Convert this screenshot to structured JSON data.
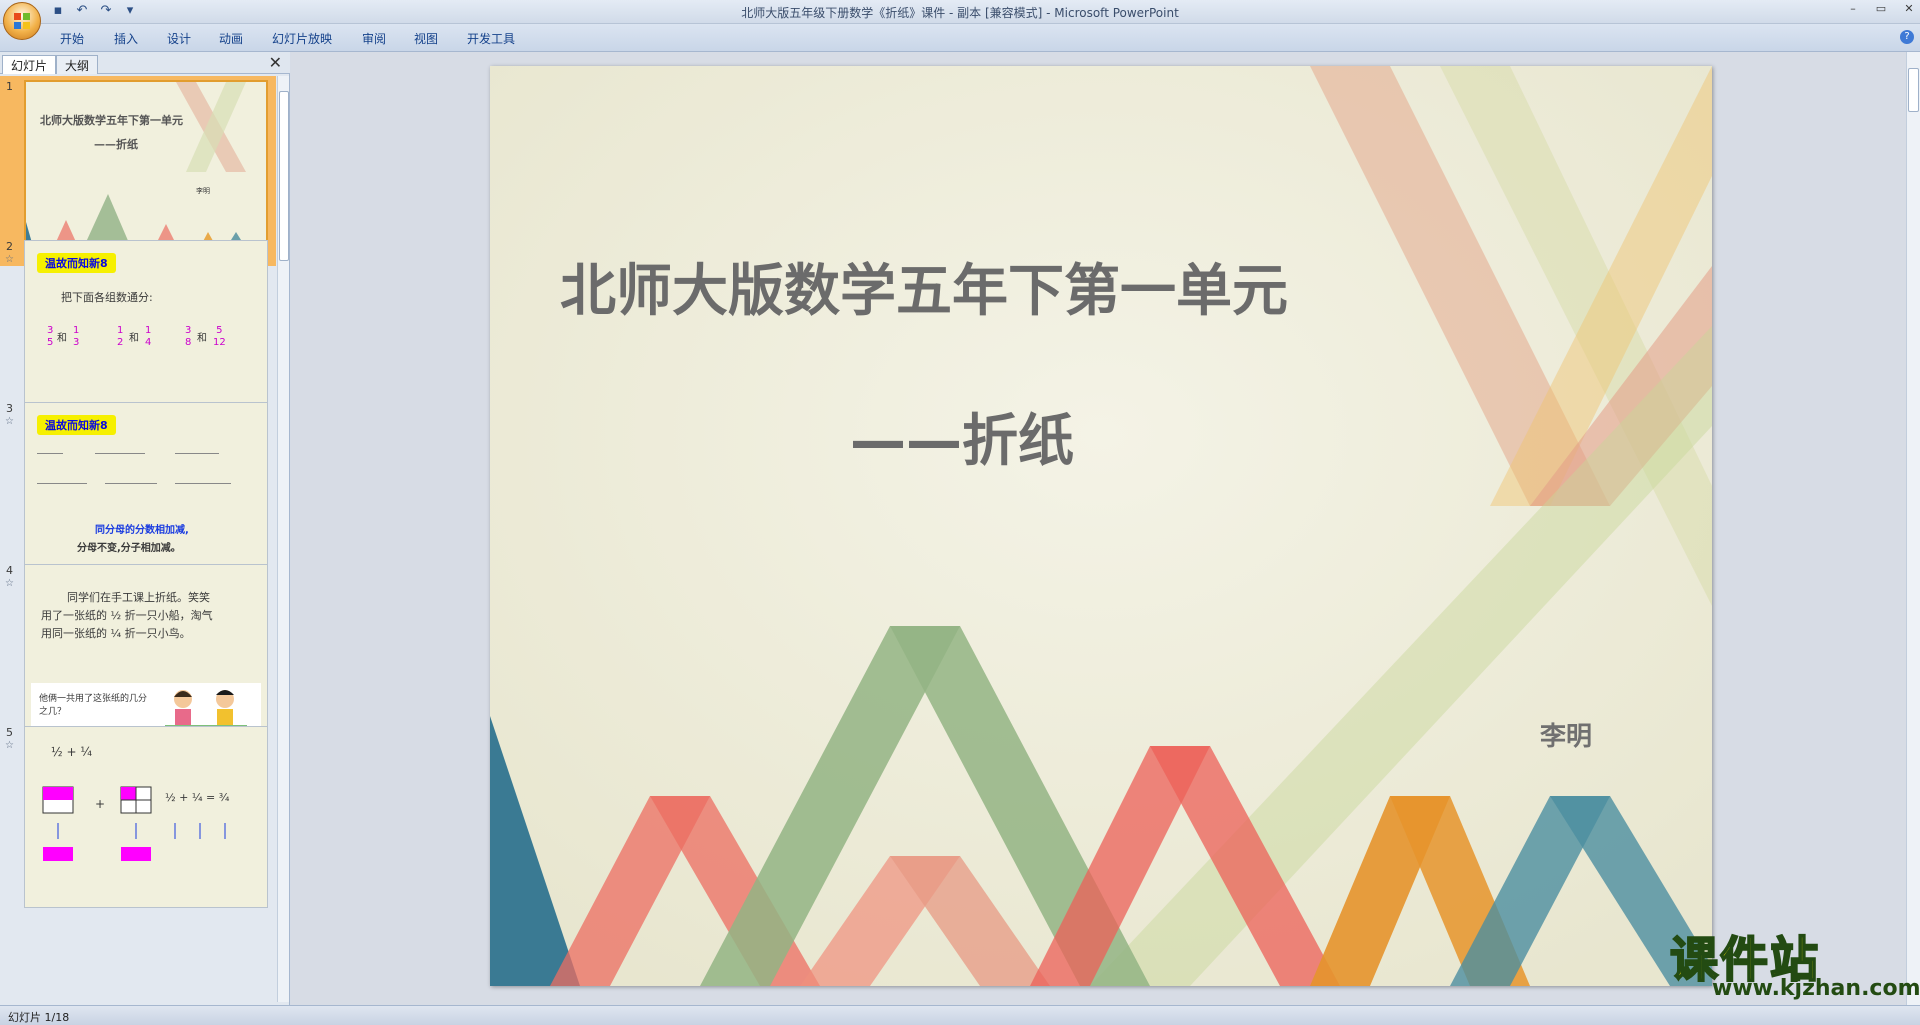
{
  "window": {
    "title": "北师大版五年级下册数学《折纸》课件 - 副本 [兼容模式] - Microsoft PowerPoint",
    "controls": [
      "–",
      "▭",
      "✕"
    ]
  },
  "quick_access": {
    "icons": [
      "save-icon",
      "undo-icon",
      "redo-icon",
      "customize-icon"
    ],
    "glyphs": [
      "▪",
      "↶",
      "↷",
      "▾"
    ]
  },
  "ribbon": {
    "tabs": [
      "开始",
      "插入",
      "设计",
      "动画",
      "幻灯片放映",
      "审阅",
      "视图",
      "开发工具"
    ],
    "help": "?"
  },
  "left_panel": {
    "tabs": [
      "幻灯片",
      "大纲"
    ],
    "close": "✕"
  },
  "thumbnails": {
    "t1": {
      "num": "1",
      "title": "北师大版数学五年下第一单元",
      "subtitle": "——折纸",
      "author": "李明"
    },
    "t2": {
      "num": "2",
      "badge": "温故而知新8",
      "text": "把下面各组数通分:",
      "and": "和",
      "fracs": [
        [
          "3",
          "5"
        ],
        [
          "1",
          "3"
        ],
        [
          "1",
          "2"
        ],
        [
          "1",
          "4"
        ],
        [
          "3",
          "8"
        ],
        [
          "5",
          "12"
        ]
      ]
    },
    "t3": {
      "num": "3",
      "badge": "温故而知新8",
      "rule1": "同分母的分数相加减,",
      "rule2": "分母不变,分子相加减。"
    },
    "t4": {
      "num": "4",
      "line1": "同学们在手工课上折纸。笑笑",
      "line2": "用了一张纸的 ½ 折一只小船，淘气",
      "line3": "用同一张纸的 ¼ 折一只小鸟。",
      "bubble": "他俩一共用了这张纸的几分之几？"
    },
    "t5": {
      "num": "5",
      "expr": "½ + ¼",
      "expr2": "½ + ¼ = ¾",
      "plus": "+"
    }
  },
  "slide": {
    "title": "北师大版数学五年下第一单元",
    "subtitle": "——折纸",
    "author": "李明"
  },
  "status": {
    "text": "幻灯片 1/18"
  },
  "watermark": {
    "main": "课件站",
    "url": "www.kjzhan.com"
  },
  "colors": {
    "accent": "#15428b",
    "selected_thumb": "#f7b860"
  }
}
